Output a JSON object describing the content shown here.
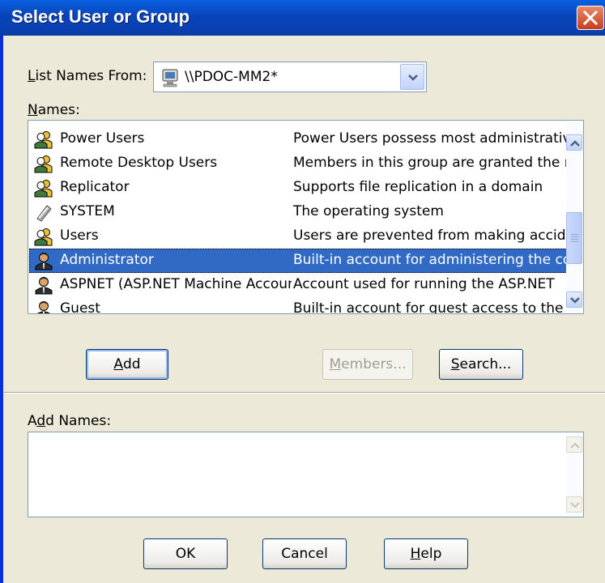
{
  "window": {
    "title": "Select User or Group"
  },
  "list_names_from": {
    "label_u": "L",
    "label_rest": "ist Names From:",
    "value": "\\\\PDOC-MM2*"
  },
  "names": {
    "label_u": "N",
    "label_rest": "ames:",
    "rows": [
      {
        "name": "Power Users",
        "description": "Power Users possess most administrative",
        "icon": "group-icon"
      },
      {
        "name": "Remote Desktop Users",
        "description": "Members in this group are granted the right",
        "icon": "group-icon"
      },
      {
        "name": "Replicator",
        "description": "Supports file replication in a domain",
        "icon": "group-icon"
      },
      {
        "name": "SYSTEM",
        "description": "The operating system",
        "icon": "system-icon"
      },
      {
        "name": "Users",
        "description": "Users are prevented from making accidental",
        "icon": "group-icon"
      },
      {
        "name": "Administrator",
        "description": "Built-in account for administering the computer",
        "icon": "user-icon",
        "selected": true
      },
      {
        "name": "ASPNET (ASP.NET Machine Account)",
        "description": "Account used for running the ASP.NET",
        "icon": "user-icon"
      },
      {
        "name": "Guest",
        "description": "Built-in account for guest access to the",
        "icon": "user-icon"
      }
    ]
  },
  "buttons": {
    "add_u": "A",
    "add_rest": "dd",
    "members_u": "M",
    "members_rest": "embers...",
    "search_u": "S",
    "search_rest": "earch...",
    "ok": "OK",
    "cancel": "Cancel",
    "help_u": "H",
    "help_rest": "elp"
  },
  "add_names": {
    "label_pre": "A",
    "label_u": "d",
    "label_post": "d Names:",
    "value": ""
  },
  "colors": {
    "titlebar": "#0a3fb0",
    "selection": "#316ac5",
    "dialog_bg": "#ece9d8"
  }
}
